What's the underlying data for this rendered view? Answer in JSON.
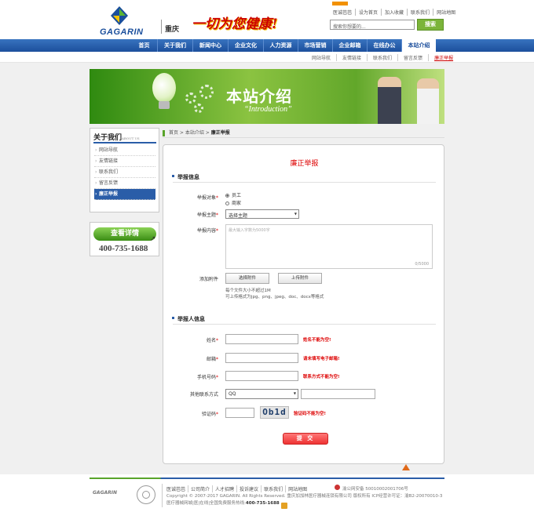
{
  "header": {
    "brand": "GAGARIN",
    "city": "重庆",
    "slogan": "一切为您健康!",
    "top_links": [
      "医诚芭芭",
      "设为首页",
      "加入收藏",
      "联系我们",
      "网站地图"
    ],
    "search_placeholder": "搜索你想要的...",
    "search_button": "搜索"
  },
  "nav": {
    "items": [
      "首页",
      "关于我们",
      "新闻中心",
      "企业文化",
      "人力资源",
      "市场营销",
      "企业邮箱",
      "在线办公",
      "本站介绍"
    ],
    "active_index": 8
  },
  "subnav": {
    "items": [
      "网站导航",
      "友情链接",
      "联系我们",
      "留言反馈",
      "廉正举报"
    ],
    "active_index": 4
  },
  "banner": {
    "title": "本站介绍",
    "subtitle": "“Introduction”"
  },
  "sidebar": {
    "title": "关于我们",
    "title_en": "ABOUT US",
    "items": [
      "网站导航",
      "友情链接",
      "联系我们",
      "留言反馈",
      "廉正举报"
    ],
    "active_index": 4,
    "detail_button": "查看详情",
    "phone": "400-735-1688"
  },
  "breadcrumb": {
    "home": "首页",
    "parent": "本站介绍",
    "current": "廉正举报"
  },
  "form": {
    "title": "廉正举报",
    "section1": "举报信息",
    "target_label": "举报对象",
    "target_options": [
      "员工",
      "商家"
    ],
    "subject_label": "举报主题",
    "subject_value": "选择主题",
    "content_label": "举报内容",
    "content_placeholder": "最大输入字数为5000字",
    "content_counter": "0/5000",
    "attach_label": "添加附件",
    "select_file_button": "选择附件",
    "upload_button": "上传附件",
    "attach_hint1": "每个文件大小不超过1M",
    "attach_hint2": "可上传格式为jpg、png、jpeg、doc、docx等格式",
    "section2": "举报人信息",
    "name_label": "姓名",
    "name_error": "姓名不能为空!",
    "email_label": "邮箱",
    "email_error": "请未填写电子邮箱!",
    "phone_label": "手机号码",
    "phone_error": "联系方式不能为空!",
    "other_contact_label": "其他联系方式",
    "other_contact_value": "QQ",
    "captcha_label": "验证码",
    "captcha_text": "Ob1d",
    "captcha_error": "验证码不能为空!",
    "submit": "提 交"
  },
  "footer": {
    "links": [
      "医诚芭芭",
      "公司简介",
      "人才招聘",
      "投诉建议",
      "联系我们",
      "网站地图"
    ],
    "copyright": "Copyright © 2007-2017 GAGARIN. All Rights Reserved. 重庆加加林医疗器械连锁有限公司 版权所有  ICP经营许可证：渝B2-20070010-3",
    "service": "医疗器械网城|医|在线|全国免费服务热线:",
    "hotline": "400-735-1688",
    "police": "渝公网安备 50010002001706号"
  },
  "colors": {
    "nav_blue": "#1c4f9c",
    "green": "#59a42a",
    "error_red": "#dd0000"
  }
}
